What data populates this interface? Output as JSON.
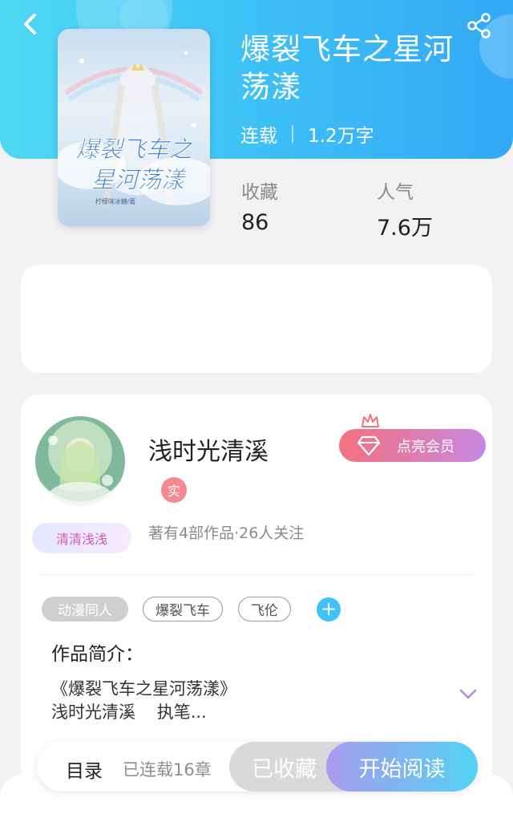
{
  "header": {
    "back_icon": "chevron-left-icon",
    "share_icon": "share-icon"
  },
  "book": {
    "title_line1": "爆裂飞车之星河",
    "title_line2": "荡漾",
    "status": "连载",
    "word_count": "1.2万字",
    "cover": {
      "title_line1": "爆裂飞车之",
      "title_line2": "星河荡漾",
      "byline": "柠檬味冰糖/著"
    }
  },
  "stats": {
    "favorites_label": "收藏",
    "favorites_value": "86",
    "popularity_label": "人气",
    "popularity_value": "7.6万"
  },
  "author": {
    "name": "浅时光清溪",
    "verified_label": "实",
    "nickname_badge": "清清浅浅",
    "summary": "著有4部作品·26人关注",
    "vip_button": "点亮会员"
  },
  "tags": [
    "动漫同人",
    "爆裂飞车",
    "飞伦"
  ],
  "tag_add": "+",
  "intro": {
    "heading": "作品简介：",
    "text": "《爆裂飞车之星河荡漾》\n浅时光清溪    执笔..."
  },
  "bottom_bar": {
    "toc": "目录",
    "chapter_count": "已连载16章",
    "favorited": "已收藏",
    "start_reading": "开始阅读"
  },
  "colors": {
    "header_gradient_start": "#4fd8f4",
    "header_gradient_end": "#33a8f5",
    "vip_gradient_start": "#f5717f",
    "vip_gradient_end": "#c588e2",
    "read_gradient_start": "#a89bf0",
    "read_gradient_end": "#52d2f2",
    "accent_blue": "#3fc3f6"
  }
}
